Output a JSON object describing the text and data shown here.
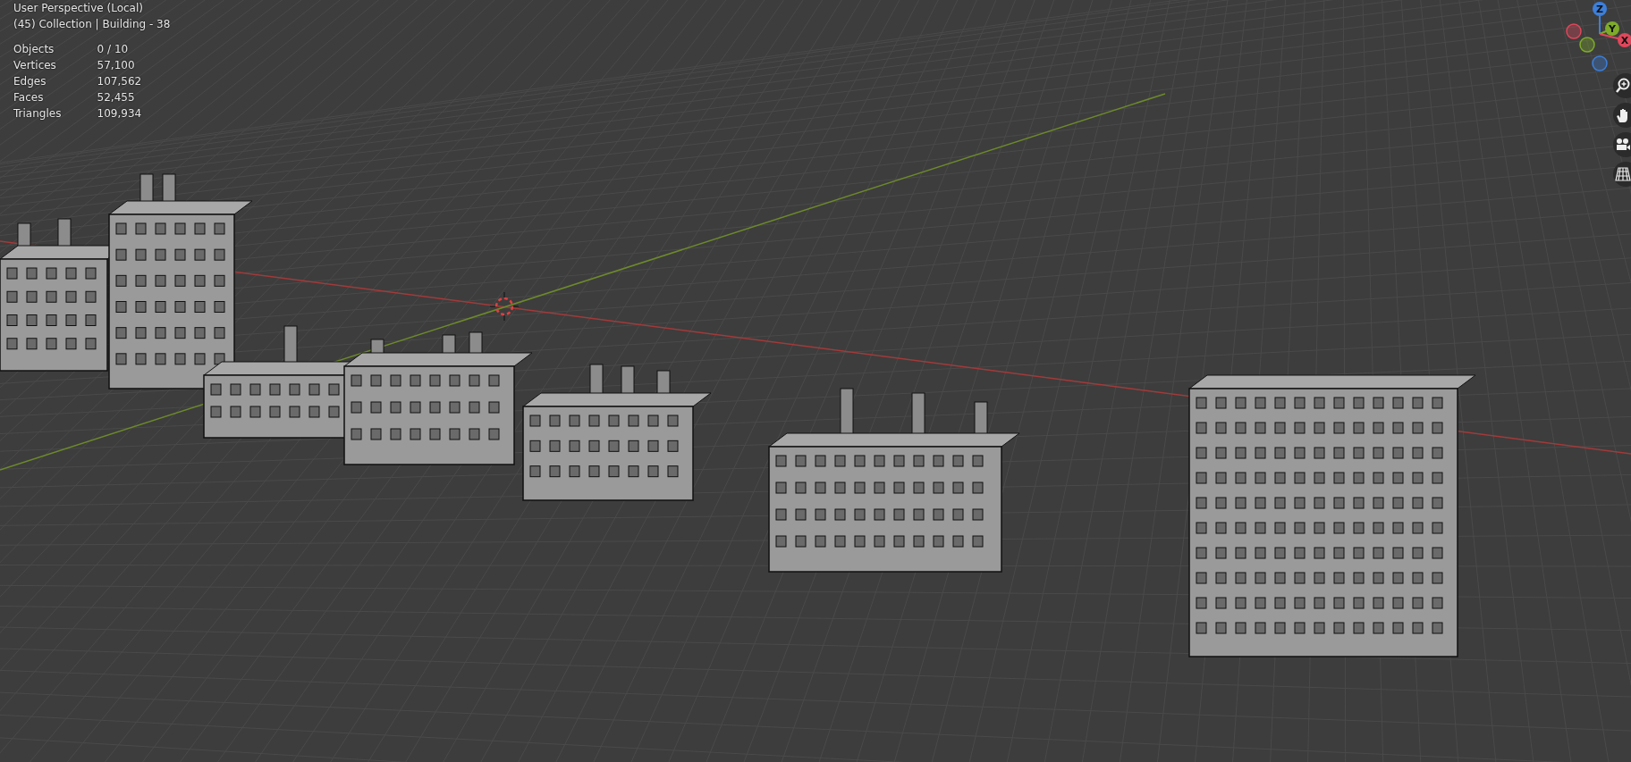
{
  "viewport": {
    "view_name": "User Perspective (Local)",
    "context": "(45) Collection | Building - 38"
  },
  "statistics": [
    {
      "label": "Objects",
      "value": "0 / 10"
    },
    {
      "label": "Vertices",
      "value": "57,100"
    },
    {
      "label": "Edges",
      "value": "107,562"
    },
    {
      "label": "Faces",
      "value": "52,455"
    },
    {
      "label": "Triangles",
      "value": "109,934"
    }
  ],
  "gizmo_axes": [
    {
      "label": "Z",
      "color": "#3d7fd9"
    },
    {
      "label": "Y",
      "color": "#7eab2a"
    },
    {
      "label": "X",
      "color": "#e0475b"
    }
  ]
}
